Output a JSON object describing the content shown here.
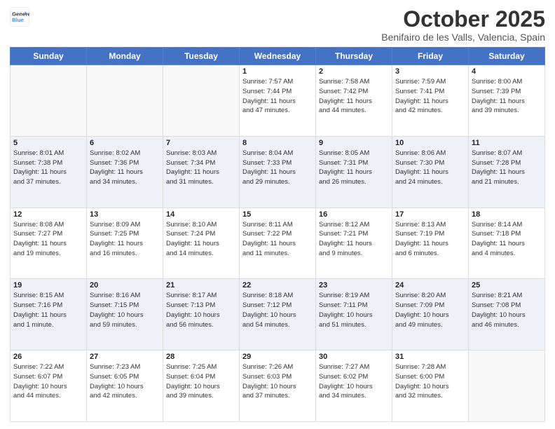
{
  "header": {
    "logo_line1": "General",
    "logo_line2": "Blue",
    "month": "October 2025",
    "location": "Benifairo de les Valls, Valencia, Spain"
  },
  "days_of_week": [
    "Sunday",
    "Monday",
    "Tuesday",
    "Wednesday",
    "Thursday",
    "Friday",
    "Saturday"
  ],
  "weeks": [
    [
      {
        "day": "",
        "info": ""
      },
      {
        "day": "",
        "info": ""
      },
      {
        "day": "",
        "info": ""
      },
      {
        "day": "1",
        "info": "Sunrise: 7:57 AM\nSunset: 7:44 PM\nDaylight: 11 hours\nand 47 minutes."
      },
      {
        "day": "2",
        "info": "Sunrise: 7:58 AM\nSunset: 7:42 PM\nDaylight: 11 hours\nand 44 minutes."
      },
      {
        "day": "3",
        "info": "Sunrise: 7:59 AM\nSunset: 7:41 PM\nDaylight: 11 hours\nand 42 minutes."
      },
      {
        "day": "4",
        "info": "Sunrise: 8:00 AM\nSunset: 7:39 PM\nDaylight: 11 hours\nand 39 minutes."
      }
    ],
    [
      {
        "day": "5",
        "info": "Sunrise: 8:01 AM\nSunset: 7:38 PM\nDaylight: 11 hours\nand 37 minutes."
      },
      {
        "day": "6",
        "info": "Sunrise: 8:02 AM\nSunset: 7:36 PM\nDaylight: 11 hours\nand 34 minutes."
      },
      {
        "day": "7",
        "info": "Sunrise: 8:03 AM\nSunset: 7:34 PM\nDaylight: 11 hours\nand 31 minutes."
      },
      {
        "day": "8",
        "info": "Sunrise: 8:04 AM\nSunset: 7:33 PM\nDaylight: 11 hours\nand 29 minutes."
      },
      {
        "day": "9",
        "info": "Sunrise: 8:05 AM\nSunset: 7:31 PM\nDaylight: 11 hours\nand 26 minutes."
      },
      {
        "day": "10",
        "info": "Sunrise: 8:06 AM\nSunset: 7:30 PM\nDaylight: 11 hours\nand 24 minutes."
      },
      {
        "day": "11",
        "info": "Sunrise: 8:07 AM\nSunset: 7:28 PM\nDaylight: 11 hours\nand 21 minutes."
      }
    ],
    [
      {
        "day": "12",
        "info": "Sunrise: 8:08 AM\nSunset: 7:27 PM\nDaylight: 11 hours\nand 19 minutes."
      },
      {
        "day": "13",
        "info": "Sunrise: 8:09 AM\nSunset: 7:25 PM\nDaylight: 11 hours\nand 16 minutes."
      },
      {
        "day": "14",
        "info": "Sunrise: 8:10 AM\nSunset: 7:24 PM\nDaylight: 11 hours\nand 14 minutes."
      },
      {
        "day": "15",
        "info": "Sunrise: 8:11 AM\nSunset: 7:22 PM\nDaylight: 11 hours\nand 11 minutes."
      },
      {
        "day": "16",
        "info": "Sunrise: 8:12 AM\nSunset: 7:21 PM\nDaylight: 11 hours\nand 9 minutes."
      },
      {
        "day": "17",
        "info": "Sunrise: 8:13 AM\nSunset: 7:19 PM\nDaylight: 11 hours\nand 6 minutes."
      },
      {
        "day": "18",
        "info": "Sunrise: 8:14 AM\nSunset: 7:18 PM\nDaylight: 11 hours\nand 4 minutes."
      }
    ],
    [
      {
        "day": "19",
        "info": "Sunrise: 8:15 AM\nSunset: 7:16 PM\nDaylight: 11 hours\nand 1 minute."
      },
      {
        "day": "20",
        "info": "Sunrise: 8:16 AM\nSunset: 7:15 PM\nDaylight: 10 hours\nand 59 minutes."
      },
      {
        "day": "21",
        "info": "Sunrise: 8:17 AM\nSunset: 7:13 PM\nDaylight: 10 hours\nand 56 minutes."
      },
      {
        "day": "22",
        "info": "Sunrise: 8:18 AM\nSunset: 7:12 PM\nDaylight: 10 hours\nand 54 minutes."
      },
      {
        "day": "23",
        "info": "Sunrise: 8:19 AM\nSunset: 7:11 PM\nDaylight: 10 hours\nand 51 minutes."
      },
      {
        "day": "24",
        "info": "Sunrise: 8:20 AM\nSunset: 7:09 PM\nDaylight: 10 hours\nand 49 minutes."
      },
      {
        "day": "25",
        "info": "Sunrise: 8:21 AM\nSunset: 7:08 PM\nDaylight: 10 hours\nand 46 minutes."
      }
    ],
    [
      {
        "day": "26",
        "info": "Sunrise: 7:22 AM\nSunset: 6:07 PM\nDaylight: 10 hours\nand 44 minutes."
      },
      {
        "day": "27",
        "info": "Sunrise: 7:23 AM\nSunset: 6:05 PM\nDaylight: 10 hours\nand 42 minutes."
      },
      {
        "day": "28",
        "info": "Sunrise: 7:25 AM\nSunset: 6:04 PM\nDaylight: 10 hours\nand 39 minutes."
      },
      {
        "day": "29",
        "info": "Sunrise: 7:26 AM\nSunset: 6:03 PM\nDaylight: 10 hours\nand 37 minutes."
      },
      {
        "day": "30",
        "info": "Sunrise: 7:27 AM\nSunset: 6:02 PM\nDaylight: 10 hours\nand 34 minutes."
      },
      {
        "day": "31",
        "info": "Sunrise: 7:28 AM\nSunset: 6:00 PM\nDaylight: 10 hours\nand 32 minutes."
      },
      {
        "day": "",
        "info": ""
      }
    ]
  ]
}
